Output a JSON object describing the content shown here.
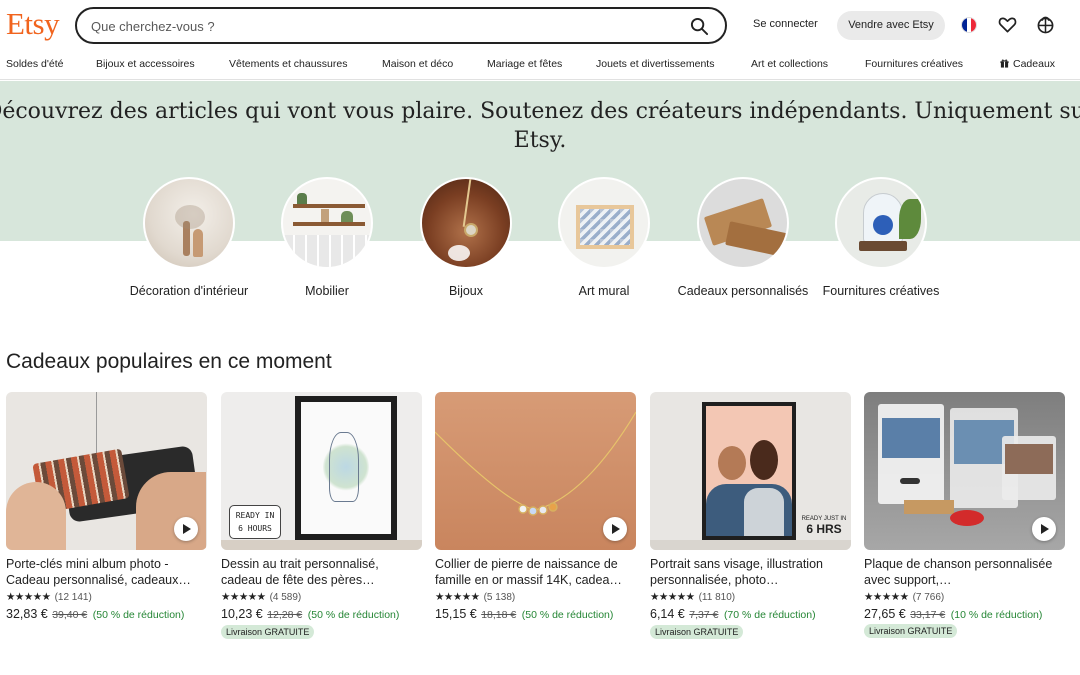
{
  "header": {
    "logo": "Etsy",
    "search_placeholder": "Que cherchez-vous ?",
    "signin": "Se connecter",
    "sell": "Vendre avec Etsy",
    "icons": [
      "search-icon",
      "france-flag-icon",
      "heart-icon",
      "cart-icon"
    ]
  },
  "nav": {
    "items": [
      "Soldes d'été",
      "Bijoux et accessoires",
      "Vêtements et chaussures",
      "Maison et déco",
      "Mariage et fêtes",
      "Jouets et divertissements",
      "Art et collections",
      "Fournitures créatives",
      "Cadeaux"
    ]
  },
  "hero": {
    "title": "Découvrez des articles qui vont vous plaire. Soutenez des créateurs indépendants. Uniquement sur Etsy."
  },
  "categories": [
    {
      "label": "Décoration d'intérieur"
    },
    {
      "label": "Mobilier"
    },
    {
      "label": "Bijoux"
    },
    {
      "label": "Art mural"
    },
    {
      "label": "Cadeaux personnalisés"
    },
    {
      "label": "Fournitures créatives"
    }
  ],
  "section": {
    "title": "Cadeaux populaires en ce moment"
  },
  "products": [
    {
      "title": "Porte-clés mini album photo - Cadeau personnalisé, cadeaux…",
      "stars": "★★★★★",
      "reviews": "(12 141)",
      "price": "32,83 €",
      "old_price": "39,40 €",
      "discount": "(50 % de réduction)",
      "free_shipping": ""
    },
    {
      "title": "Dessin au trait personnalisé, cadeau de fête des pères…",
      "stars": "★★★★★",
      "reviews": "(4 589)",
      "price": "10,23 €",
      "old_price": "12,28 €",
      "discount": "(50 % de réduction)",
      "free_shipping": "Livraison GRATUITE"
    },
    {
      "title": "Collier de pierre de naissance de famille en or massif 14K, cadea…",
      "stars": "★★★★★",
      "reviews": "(5 138)",
      "price": "15,15 €",
      "old_price": "18,18 €",
      "discount": "(50 % de réduction)",
      "free_shipping": ""
    },
    {
      "title": "Portrait sans visage, illustration personnalisée, photo…",
      "stars": "★★★★★",
      "reviews": "(11 810)",
      "price": "6,14 €",
      "old_price": "7,37 €",
      "discount": "(70 % de réduction)",
      "free_shipping": "Livraison GRATUITE"
    },
    {
      "title": "Plaque de chanson personnalisée avec support,…",
      "stars": "★★★★★",
      "reviews": "(7 766)",
      "price": "27,65 €",
      "old_price": "33,17 €",
      "discount": "(10 % de réduction)",
      "free_shipping": "Livraison GRATUITE"
    }
  ],
  "image_text": {
    "ready_in": "READY IN",
    "hours": "6 HOURS",
    "ready_just_in": "READY JUST IN",
    "hrs": "6 HRS"
  },
  "colors": {
    "brand": "#F1641E",
    "hero_bg": "#D7E6DB",
    "discount": "#258635",
    "free_badge": "#D4E9D7"
  }
}
